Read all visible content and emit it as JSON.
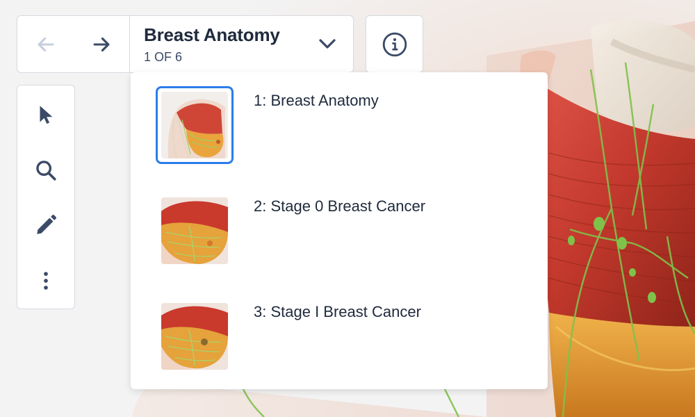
{
  "navigation": {
    "prev_icon": "arrow-left-icon",
    "next_icon": "arrow-right-icon",
    "title": "Breast Anatomy",
    "counter": "1 OF 6",
    "dropdown_icon": "chevron-down-icon",
    "info_icon": "info-icon"
  },
  "toolbar": {
    "tools": [
      {
        "name": "select",
        "icon": "cursor-pointer-icon"
      },
      {
        "name": "zoom",
        "icon": "search-icon"
      },
      {
        "name": "draw",
        "icon": "pencil-icon"
      },
      {
        "name": "more",
        "icon": "more-vertical-icon"
      }
    ]
  },
  "dropdown": {
    "items": [
      {
        "label": "1: Breast Anatomy",
        "selected": true
      },
      {
        "label": "2: Stage 0 Breast Cancer",
        "selected": false
      },
      {
        "label": "3: Stage I Breast Cancer",
        "selected": false
      }
    ]
  },
  "colors": {
    "text_dark": "#1f2a3c",
    "icon": "#3b4a66",
    "icon_disabled": "#c7cfdc",
    "selection": "#2b7de9",
    "muscle": "#c2382c",
    "lymph": "#7fc24a",
    "tissue": "#e8a23a"
  }
}
